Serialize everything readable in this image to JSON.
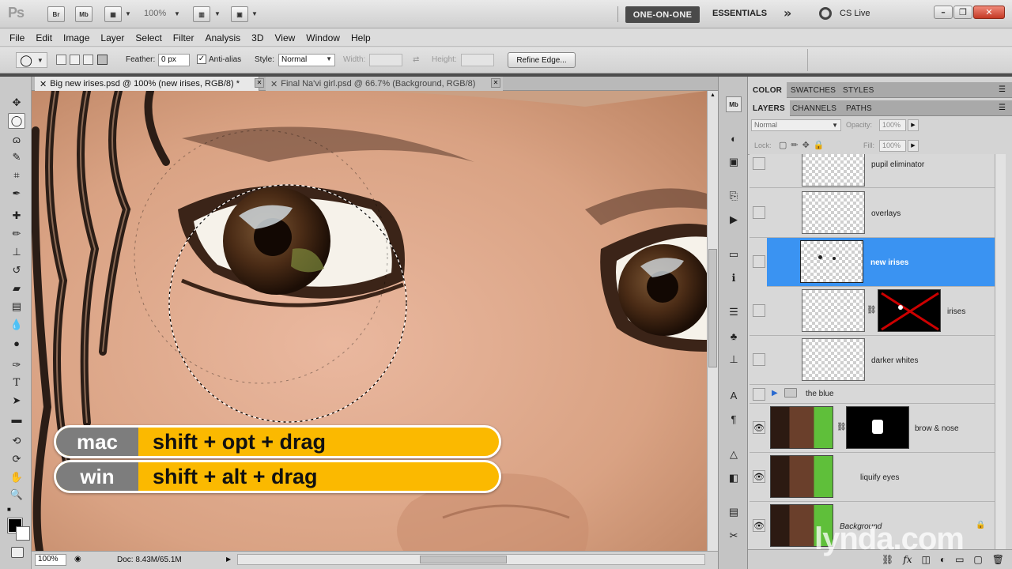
{
  "app": {
    "logo": "Ps",
    "zoom": "100%",
    "bridge": "Br",
    "minibridge": "Mb"
  },
  "workspace": {
    "active": "ONE-ON-ONE",
    "other": "ESSENTIALS",
    "more": "»",
    "cslive": "CS Live"
  },
  "menu": [
    "File",
    "Edit",
    "Image",
    "Layer",
    "Select",
    "Filter",
    "Analysis",
    "3D",
    "View",
    "Window",
    "Help"
  ],
  "options": {
    "feather_label": "Feather:",
    "feather_value": "0 px",
    "antialias_label": "Anti-alias",
    "style_label": "Style:",
    "style_value": "Normal",
    "width_label": "Width:",
    "height_label": "Height:",
    "refine_edge": "Refine Edge..."
  },
  "tabs": [
    {
      "label": "Big new irises.psd @ 100% (new irises, RGB/8) *",
      "active": true
    },
    {
      "label": "Final Na'vi girl.psd @ 66.7% (Background, RGB/8)",
      "active": false
    }
  ],
  "shortcut": {
    "mac": {
      "os": "mac",
      "keys": "shift + opt + drag"
    },
    "win": {
      "os": "win",
      "keys": "shift + alt + drag"
    }
  },
  "status": {
    "zoom": "100%",
    "doc": "Doc: 8.43M/65.1M"
  },
  "panels": {
    "top_tabs": [
      "COLOR",
      "SWATCHES",
      "STYLES"
    ],
    "layer_tabs": [
      "LAYERS",
      "CHANNELS",
      "PATHS"
    ],
    "blend_mode": "Normal",
    "opacity_label": "Opacity:",
    "opacity_value": "100%",
    "lock_label": "Lock:",
    "fill_label": "Fill:",
    "fill_value": "100%"
  },
  "layers": [
    {
      "name": "pupil eliminator",
      "selected": false
    },
    {
      "name": "overlays",
      "selected": false
    },
    {
      "name": "new irises",
      "selected": true
    },
    {
      "name": "irises",
      "selected": false
    },
    {
      "name": "darker whites",
      "selected": false
    },
    {
      "name": "the blue",
      "selected": false
    },
    {
      "name": "brow & nose",
      "selected": false
    },
    {
      "name": "liquify eyes",
      "selected": false
    },
    {
      "name": "Background",
      "selected": false
    }
  ],
  "watermark": "lynda.com",
  "colors": {
    "selected_layer": "#3a93f2",
    "badge": "#fbb900",
    "badge_os": "#7d7d7d"
  }
}
